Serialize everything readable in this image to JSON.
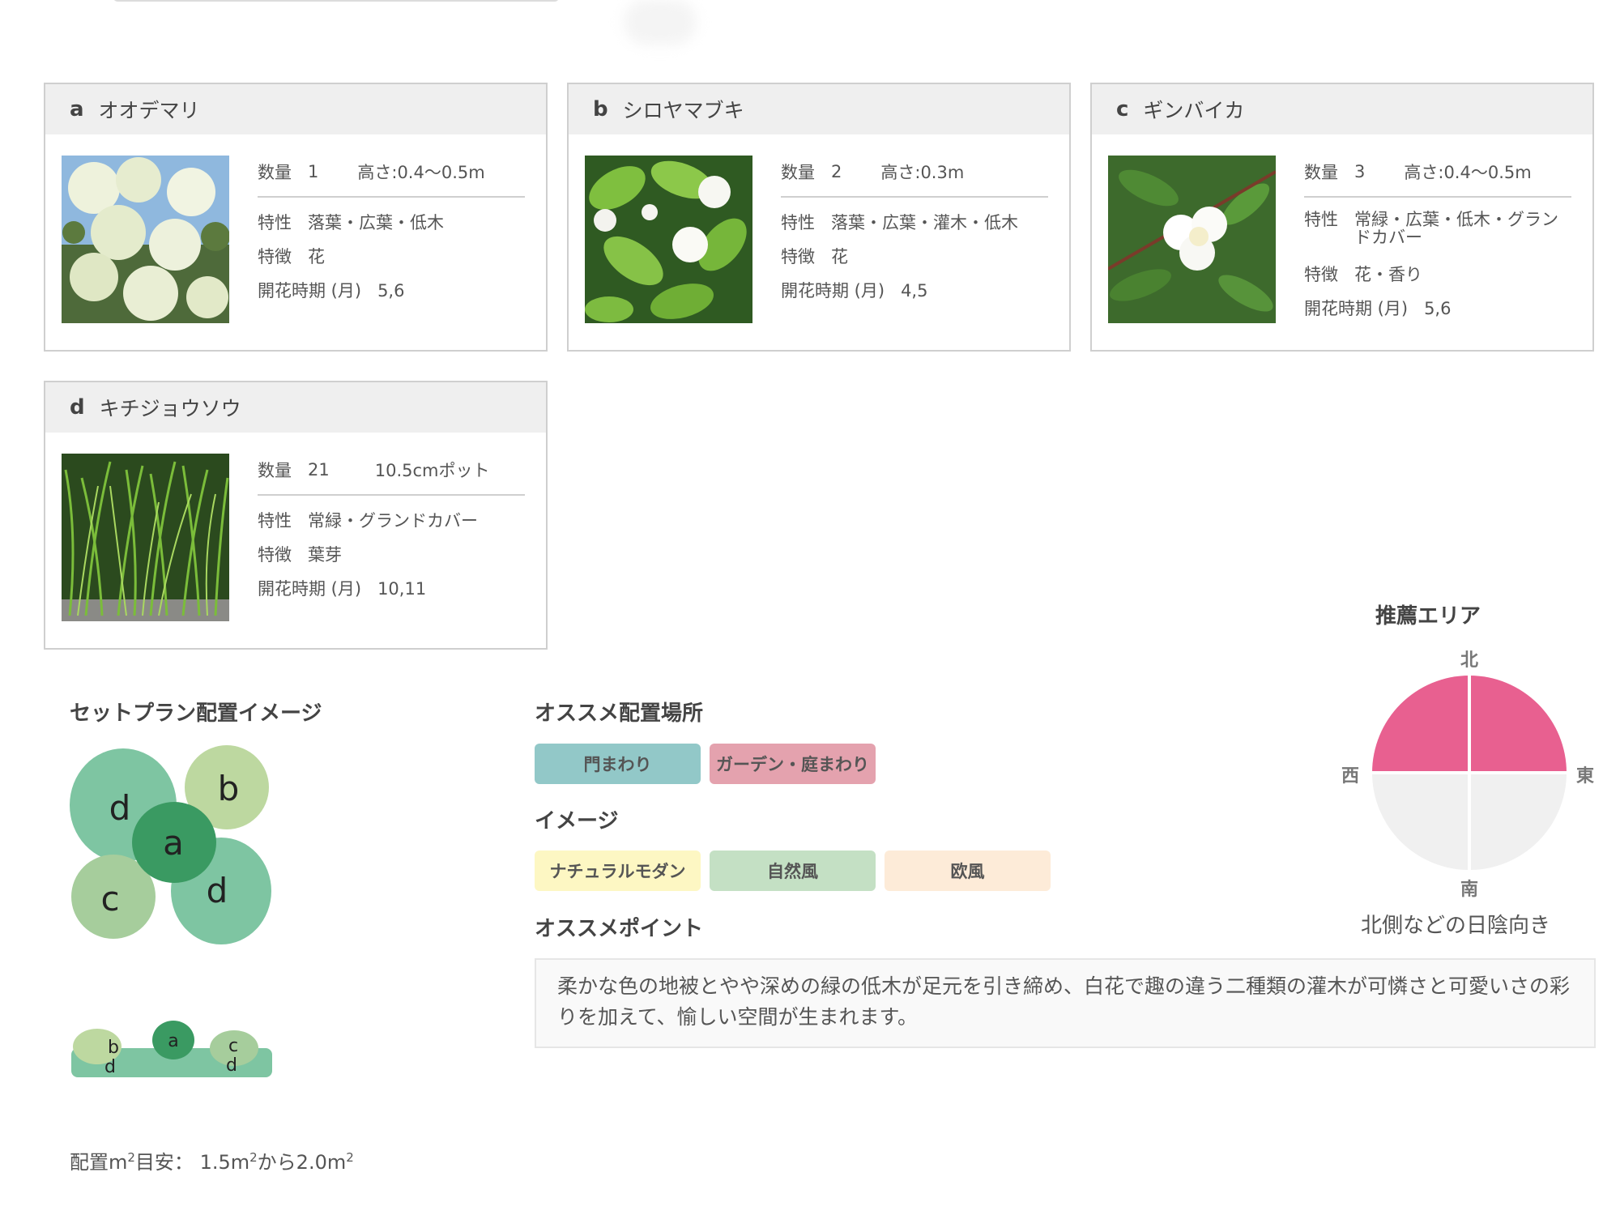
{
  "cards": [
    {
      "letter": "a",
      "name": "オオデマリ",
      "qty_label": "数量",
      "qty": "1",
      "size": "高さ:0.4〜0.5m",
      "trait_label": "特性",
      "trait": "落葉・広葉・低木",
      "feature_label": "特徴",
      "feature": "花",
      "bloom_label": "開花時期 (月)",
      "bloom": "5,6"
    },
    {
      "letter": "b",
      "name": "シロヤマブキ",
      "qty_label": "数量",
      "qty": "2",
      "size": "高さ:0.3m",
      "trait_label": "特性",
      "trait": "落葉・広葉・灌木・低木",
      "feature_label": "特徴",
      "feature": "花",
      "bloom_label": "開花時期 (月)",
      "bloom": "4,5"
    },
    {
      "letter": "c",
      "name": "ギンバイカ",
      "qty_label": "数量",
      "qty": "3",
      "size": "高さ:0.4〜0.5m",
      "trait_label": "特性",
      "trait": "常緑・広葉・低木・グランドカバー",
      "feature_label": "特徴",
      "feature": "花・香り",
      "bloom_label": "開花時期 (月)",
      "bloom": "5,6"
    },
    {
      "letter": "d",
      "name": "キチジョウソウ",
      "qty_label": "数量",
      "qty": "21",
      "size": "10.5cmポット",
      "trait_label": "特性",
      "trait": "常緑・グランドカバー",
      "feature_label": "特徴",
      "feature": "葉芽",
      "bloom_label": "開花時期 (月)",
      "bloom": "10,11"
    }
  ],
  "plan": {
    "title": "セットプラン配置イメージ",
    "plan_letters": [
      "d",
      "b",
      "a",
      "c",
      "d"
    ],
    "elev_letters": [
      "b",
      "d",
      "a",
      "c",
      "d"
    ]
  },
  "location": {
    "title": "オススメ配置場所",
    "tags": [
      "門まわり",
      "ガーデン・庭まわり"
    ]
  },
  "image": {
    "title": "イメージ",
    "tags": [
      "ナチュラルモダン",
      "自然風",
      "欧風"
    ]
  },
  "point": {
    "title": "オススメポイント",
    "text": "柔かな色の地被とやや深めの緑の低木が足元を引き締め、白花で趣の違う二種類の灌木が可憐さと可愛いさの彩りを加えて、愉しい空間が生まれます。"
  },
  "area": {
    "title": "推薦エリア",
    "north": "北",
    "south": "南",
    "east": "東",
    "west": "西",
    "note": "北側などの日陰向き",
    "recommended_quadrants": [
      "north-west",
      "north-east"
    ],
    "colors": {
      "on": "#e86090",
      "off": "#f0f0f0"
    }
  },
  "footer": {
    "prefix": "配置m",
    "sup1": "2",
    "middle": "目安： 1.5m",
    "sup2": "2",
    "middle2": "から2.0m",
    "sup3": "2"
  },
  "colors": {
    "tag_teal": "#92c8c8",
    "tag_pink": "#e4a2ae",
    "tag_yellow": "#fdf7c3",
    "tag_green": "#c4e0c4",
    "tag_peach": "#fdebd8"
  }
}
